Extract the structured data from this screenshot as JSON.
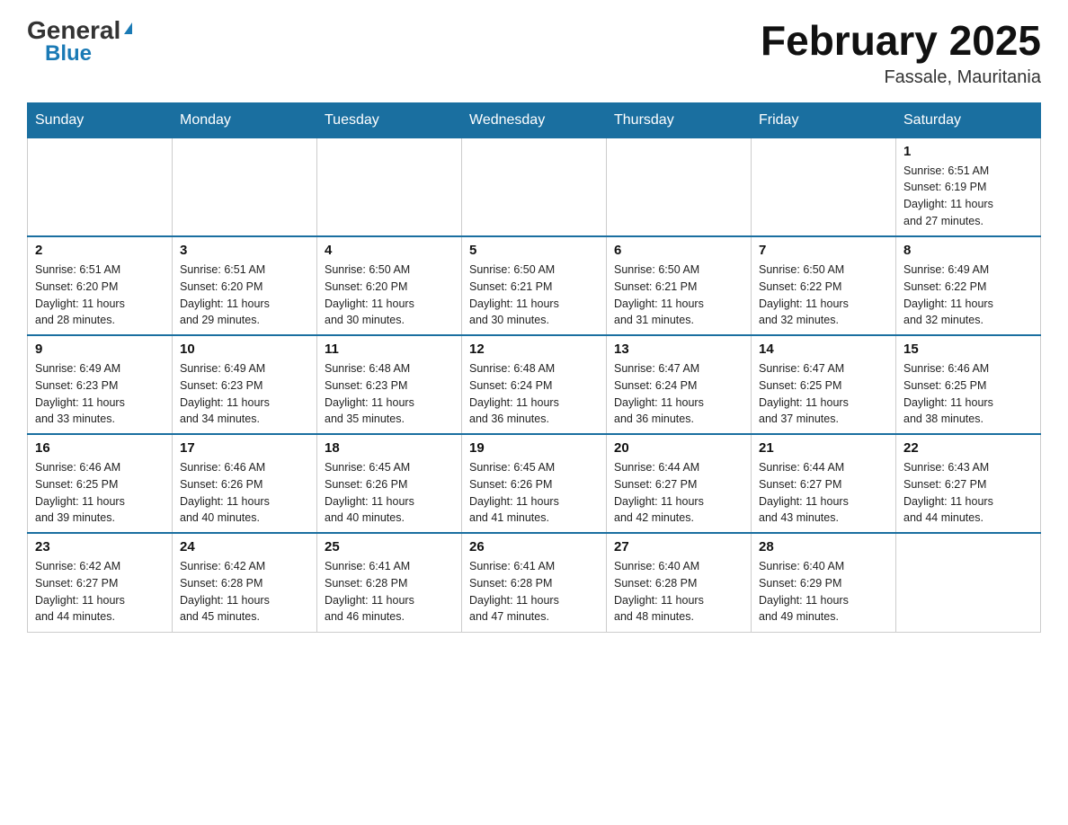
{
  "header": {
    "logo_general": "General",
    "logo_blue": "Blue",
    "month_year": "February 2025",
    "location": "Fassale, Mauritania"
  },
  "days_header": [
    "Sunday",
    "Monday",
    "Tuesday",
    "Wednesday",
    "Thursday",
    "Friday",
    "Saturday"
  ],
  "weeks": [
    [
      {
        "day": "",
        "info": ""
      },
      {
        "day": "",
        "info": ""
      },
      {
        "day": "",
        "info": ""
      },
      {
        "day": "",
        "info": ""
      },
      {
        "day": "",
        "info": ""
      },
      {
        "day": "",
        "info": ""
      },
      {
        "day": "1",
        "info": "Sunrise: 6:51 AM\nSunset: 6:19 PM\nDaylight: 11 hours\nand 27 minutes."
      }
    ],
    [
      {
        "day": "2",
        "info": "Sunrise: 6:51 AM\nSunset: 6:20 PM\nDaylight: 11 hours\nand 28 minutes."
      },
      {
        "day": "3",
        "info": "Sunrise: 6:51 AM\nSunset: 6:20 PM\nDaylight: 11 hours\nand 29 minutes."
      },
      {
        "day": "4",
        "info": "Sunrise: 6:50 AM\nSunset: 6:20 PM\nDaylight: 11 hours\nand 30 minutes."
      },
      {
        "day": "5",
        "info": "Sunrise: 6:50 AM\nSunset: 6:21 PM\nDaylight: 11 hours\nand 30 minutes."
      },
      {
        "day": "6",
        "info": "Sunrise: 6:50 AM\nSunset: 6:21 PM\nDaylight: 11 hours\nand 31 minutes."
      },
      {
        "day": "7",
        "info": "Sunrise: 6:50 AM\nSunset: 6:22 PM\nDaylight: 11 hours\nand 32 minutes."
      },
      {
        "day": "8",
        "info": "Sunrise: 6:49 AM\nSunset: 6:22 PM\nDaylight: 11 hours\nand 32 minutes."
      }
    ],
    [
      {
        "day": "9",
        "info": "Sunrise: 6:49 AM\nSunset: 6:23 PM\nDaylight: 11 hours\nand 33 minutes."
      },
      {
        "day": "10",
        "info": "Sunrise: 6:49 AM\nSunset: 6:23 PM\nDaylight: 11 hours\nand 34 minutes."
      },
      {
        "day": "11",
        "info": "Sunrise: 6:48 AM\nSunset: 6:23 PM\nDaylight: 11 hours\nand 35 minutes."
      },
      {
        "day": "12",
        "info": "Sunrise: 6:48 AM\nSunset: 6:24 PM\nDaylight: 11 hours\nand 36 minutes."
      },
      {
        "day": "13",
        "info": "Sunrise: 6:47 AM\nSunset: 6:24 PM\nDaylight: 11 hours\nand 36 minutes."
      },
      {
        "day": "14",
        "info": "Sunrise: 6:47 AM\nSunset: 6:25 PM\nDaylight: 11 hours\nand 37 minutes."
      },
      {
        "day": "15",
        "info": "Sunrise: 6:46 AM\nSunset: 6:25 PM\nDaylight: 11 hours\nand 38 minutes."
      }
    ],
    [
      {
        "day": "16",
        "info": "Sunrise: 6:46 AM\nSunset: 6:25 PM\nDaylight: 11 hours\nand 39 minutes."
      },
      {
        "day": "17",
        "info": "Sunrise: 6:46 AM\nSunset: 6:26 PM\nDaylight: 11 hours\nand 40 minutes."
      },
      {
        "day": "18",
        "info": "Sunrise: 6:45 AM\nSunset: 6:26 PM\nDaylight: 11 hours\nand 40 minutes."
      },
      {
        "day": "19",
        "info": "Sunrise: 6:45 AM\nSunset: 6:26 PM\nDaylight: 11 hours\nand 41 minutes."
      },
      {
        "day": "20",
        "info": "Sunrise: 6:44 AM\nSunset: 6:27 PM\nDaylight: 11 hours\nand 42 minutes."
      },
      {
        "day": "21",
        "info": "Sunrise: 6:44 AM\nSunset: 6:27 PM\nDaylight: 11 hours\nand 43 minutes."
      },
      {
        "day": "22",
        "info": "Sunrise: 6:43 AM\nSunset: 6:27 PM\nDaylight: 11 hours\nand 44 minutes."
      }
    ],
    [
      {
        "day": "23",
        "info": "Sunrise: 6:42 AM\nSunset: 6:27 PM\nDaylight: 11 hours\nand 44 minutes."
      },
      {
        "day": "24",
        "info": "Sunrise: 6:42 AM\nSunset: 6:28 PM\nDaylight: 11 hours\nand 45 minutes."
      },
      {
        "day": "25",
        "info": "Sunrise: 6:41 AM\nSunset: 6:28 PM\nDaylight: 11 hours\nand 46 minutes."
      },
      {
        "day": "26",
        "info": "Sunrise: 6:41 AM\nSunset: 6:28 PM\nDaylight: 11 hours\nand 47 minutes."
      },
      {
        "day": "27",
        "info": "Sunrise: 6:40 AM\nSunset: 6:28 PM\nDaylight: 11 hours\nand 48 minutes."
      },
      {
        "day": "28",
        "info": "Sunrise: 6:40 AM\nSunset: 6:29 PM\nDaylight: 11 hours\nand 49 minutes."
      },
      {
        "day": "",
        "info": ""
      }
    ]
  ]
}
